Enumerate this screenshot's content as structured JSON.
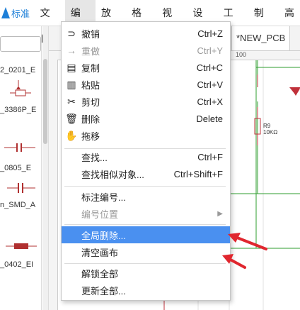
{
  "app": {
    "logo_text": "标准"
  },
  "menubar": [
    "文件",
    "编辑",
    "放置",
    "格式",
    "视图",
    "设计",
    "工具",
    "制造",
    "高"
  ],
  "library": {
    "items": [
      {
        "label": "2_0201_E"
      },
      {
        "label": "_3386P_E"
      },
      {
        "label": "_0805_E"
      },
      {
        "label": "n_SMD_A"
      },
      {
        "label": "_0402_EI"
      }
    ]
  },
  "tabs": {
    "pcb_tab": "*NEW_PCB"
  },
  "ruler": {
    "top_label": "100"
  },
  "canvas": {
    "ref": "R9",
    "value": "10KΩ"
  },
  "edit_menu": {
    "items": [
      {
        "icon": "undo-icon",
        "glyph": "⊃",
        "label": "撤销",
        "shortcut": "Ctrl+Z",
        "disabled": false
      },
      {
        "icon": "redo-icon",
        "glyph": "→",
        "label": "重做",
        "shortcut": "Ctrl+Y",
        "disabled": true
      },
      {
        "icon": "copy-icon",
        "glyph": "▤",
        "label": "复制",
        "shortcut": "Ctrl+C",
        "disabled": false
      },
      {
        "icon": "paste-icon",
        "glyph": "▥",
        "label": "粘贴",
        "shortcut": "Ctrl+V",
        "disabled": false
      },
      {
        "icon": "cut-icon",
        "glyph": "✂",
        "label": "剪切",
        "shortcut": "Ctrl+X",
        "disabled": false
      },
      {
        "icon": "trash-icon",
        "glyph": "🗑",
        "label": "删除",
        "shortcut": "Delete",
        "disabled": false
      },
      {
        "icon": "hand-icon",
        "glyph": "✋",
        "label": "拖移",
        "shortcut": "",
        "disabled": false
      },
      {
        "label": "查找...",
        "shortcut": "Ctrl+F"
      },
      {
        "label": "查找相似对象...",
        "shortcut": "Ctrl+Shift+F"
      },
      {
        "label": "标注编号..."
      },
      {
        "label": "编号位置",
        "disabled": true,
        "submenu": true
      },
      {
        "label": "全局删除...",
        "highlighted": true
      },
      {
        "label": "清空画布"
      },
      {
        "label": "解锁全部"
      },
      {
        "label": "更新全部..."
      }
    ]
  },
  "colors": {
    "highlight": "#4a90f0",
    "annotation": "#e0262e",
    "wire": "#2e9e2e",
    "component": "#c0303a"
  }
}
